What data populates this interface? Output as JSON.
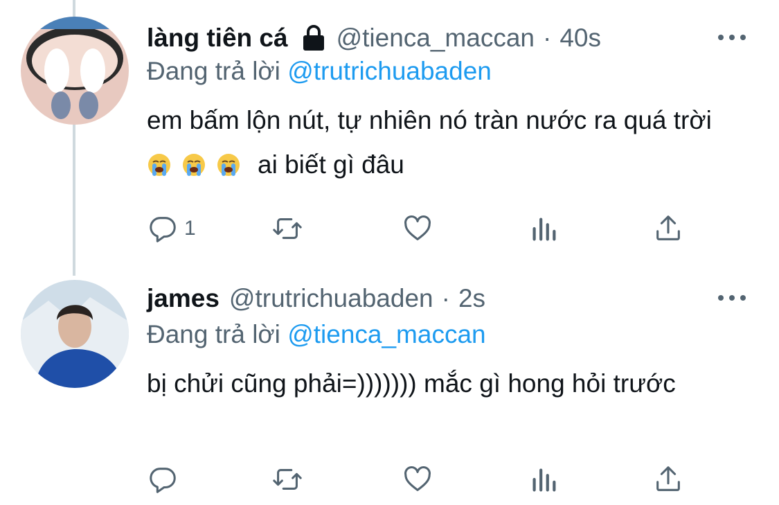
{
  "tweets": [
    {
      "name": "làng tiên cá",
      "handle": "@tienca_maccan",
      "separator": "·",
      "time": "40s",
      "replying_prefix": "Đang trả lời",
      "replying_to": "@trutrichuabaden",
      "text_before": "em bấm lộn nút, tự nhiên nó tràn nước ra quá trời",
      "emojis": [
        "loudly-crying-face",
        "loudly-crying-face",
        "loudly-crying-face"
      ],
      "text_after": "ai biết gì đâu",
      "reply_count": "1",
      "locked": true
    },
    {
      "name": "james",
      "handle": "@trutrichuabaden",
      "separator": "·",
      "time": "2s",
      "replying_prefix": "Đang trả lời",
      "replying_to": "@tienca_maccan",
      "text": "bị chửi cũng phải=))))))) mắc gì hong hỏi trước",
      "reply_count": "",
      "locked": false
    }
  ],
  "icons": [
    "lock-icon",
    "more-icon",
    "reply-icon",
    "retweet-icon",
    "like-icon",
    "analytics-icon",
    "share-icon"
  ],
  "colors": {
    "link": "#1d9bf0",
    "secondary": "#536471",
    "text": "#0f1419",
    "thread_line": "#cfd9de"
  }
}
